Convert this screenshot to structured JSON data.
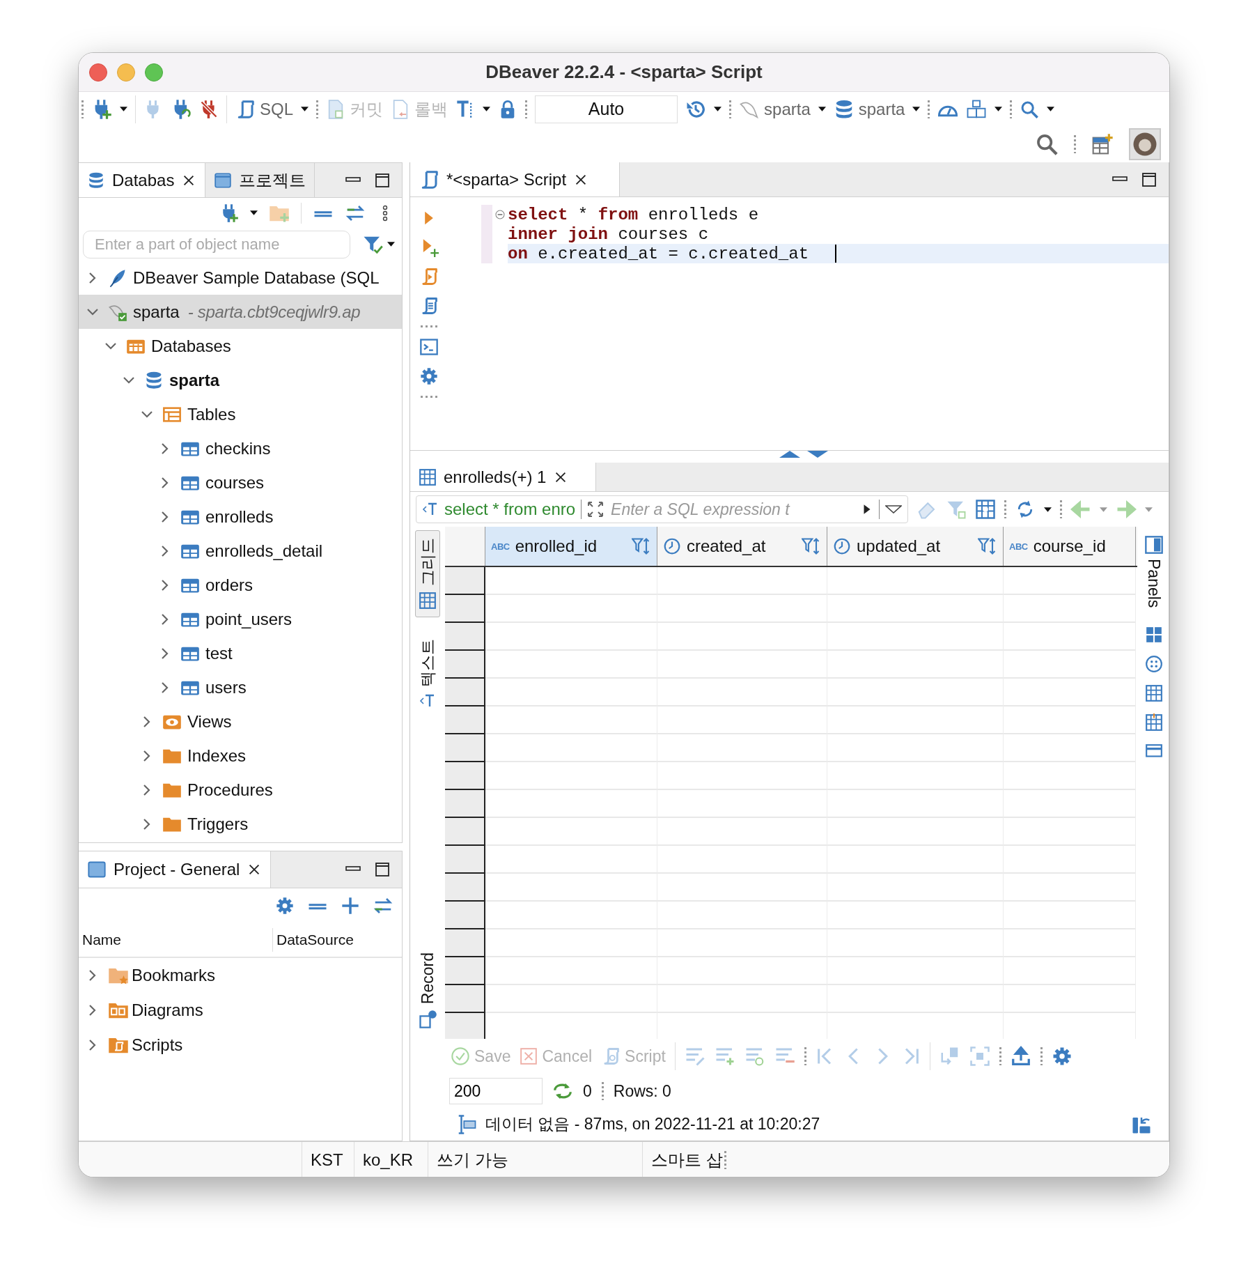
{
  "window": {
    "title": "DBeaver 22.2.4 - <sparta> Script"
  },
  "toolbar": {
    "sql": "SQL",
    "commit": {
      "label": "커밋",
      "disabled": true
    },
    "rollback": {
      "label": "롤백",
      "disabled": true
    },
    "transaction_mode": "Auto",
    "datasource": "sparta",
    "schema": "sparta"
  },
  "navigator": {
    "tabs": [
      {
        "label": "Databas",
        "selected": true
      },
      {
        "label": "프로젝트",
        "selected": false
      }
    ],
    "filter": {
      "placeholder": "Enter a part of object name"
    },
    "tree": [
      {
        "label": "DBeaver Sample Database (SQL",
        "kind": "sample-connection",
        "expanded": false,
        "selected": false
      },
      {
        "label": "sparta",
        "detail": "- sparta.cbt9ceqjwlr9.ap",
        "kind": "connection",
        "expanded": true,
        "selected": true,
        "children": [
          {
            "label": "Databases",
            "kind": "databases",
            "expanded": true,
            "selected": false,
            "children": [
              {
                "label": "sparta",
                "kind": "database",
                "expanded": true,
                "selected": false,
                "children": [
                  {
                    "label": "Tables",
                    "kind": "tables",
                    "expanded": true,
                    "selected": false,
                    "children": [
                      {
                        "label": "checkins",
                        "kind": "table",
                        "expanded": false,
                        "selected": false
                      },
                      {
                        "label": "courses",
                        "kind": "table",
                        "expanded": false,
                        "selected": false
                      },
                      {
                        "label": "enrolleds",
                        "kind": "table",
                        "expanded": false,
                        "selected": false
                      },
                      {
                        "label": "enrolleds_detail",
                        "kind": "table",
                        "expanded": false,
                        "selected": false
                      },
                      {
                        "label": "orders",
                        "kind": "table",
                        "expanded": false,
                        "selected": false
                      },
                      {
                        "label": "point_users",
                        "kind": "table",
                        "expanded": false,
                        "selected": false
                      },
                      {
                        "label": "test",
                        "kind": "table",
                        "expanded": false,
                        "selected": false
                      },
                      {
                        "label": "users",
                        "kind": "table",
                        "expanded": false,
                        "selected": false
                      }
                    ]
                  },
                  {
                    "label": "Views",
                    "kind": "views",
                    "expanded": false,
                    "selected": false
                  },
                  {
                    "label": "Indexes",
                    "kind": "folder",
                    "expanded": false,
                    "selected": false
                  },
                  {
                    "label": "Procedures",
                    "kind": "folder",
                    "expanded": false,
                    "selected": false
                  },
                  {
                    "label": "Triggers",
                    "kind": "folder",
                    "expanded": false,
                    "selected": false
                  }
                ]
              }
            ]
          }
        ]
      }
    ]
  },
  "project": {
    "tab": {
      "label": "Project - General",
      "selected": true
    },
    "columns": [
      "Name",
      "DataSource"
    ],
    "items": [
      {
        "label": "Bookmarks",
        "kind": "bookmarks",
        "expanded": false
      },
      {
        "label": "Diagrams",
        "kind": "diagrams",
        "expanded": false
      },
      {
        "label": "Scripts",
        "kind": "scripts",
        "expanded": false
      }
    ]
  },
  "editor": {
    "tab": {
      "label": "*<sparta> Script",
      "selected": true
    },
    "lines": [
      {
        "current": false,
        "tokens": [
          {
            "text": "select",
            "keyword": true
          },
          {
            "text": " * ",
            "keyword": false
          },
          {
            "text": "from",
            "keyword": true
          },
          {
            "text": " enrolleds e",
            "keyword": false
          }
        ]
      },
      {
        "current": false,
        "tokens": [
          {
            "text": "inner join",
            "keyword": true
          },
          {
            "text": " courses c",
            "keyword": false
          }
        ]
      },
      {
        "current": true,
        "tokens": [
          {
            "text": "on",
            "keyword": true
          },
          {
            "text": " e.created_at = c.created_at",
            "keyword": false
          }
        ]
      }
    ]
  },
  "results": {
    "tab": {
      "label": "enrolleds(+) 1",
      "selected": true
    },
    "query": "select * from enro",
    "filter": {
      "placeholder": "Enter a SQL expression t"
    },
    "view_tabs": [
      {
        "label": "그리드",
        "selected": true
      },
      {
        "label": "텍스트",
        "selected": false
      }
    ],
    "record": "Record",
    "panels": "Panels",
    "columns": [
      {
        "name": "enrolled_id",
        "kind": "text",
        "badge": "ABC",
        "selected": true
      },
      {
        "name": "created_at",
        "kind": "datetime",
        "selected": false
      },
      {
        "name": "updated_at",
        "kind": "datetime",
        "selected": false
      },
      {
        "name": "course_id",
        "kind": "reference",
        "badge": "ABC",
        "selected": false
      }
    ],
    "actions": [
      {
        "label": "Save",
        "kind": "save",
        "disabled": true
      },
      {
        "label": "Cancel",
        "kind": "cancel",
        "disabled": true
      },
      {
        "label": "Script",
        "kind": "script",
        "disabled": true
      }
    ],
    "fetch_size": "200",
    "refresh_count": "0",
    "rows": "Rows: 0",
    "status": "데이터 없음 - 87ms, on 2022-11-21 at 10:20:27"
  },
  "status_bar": [
    "KST",
    "ko_KR",
    "쓰기 가능",
    "스마트 삽"
  ]
}
